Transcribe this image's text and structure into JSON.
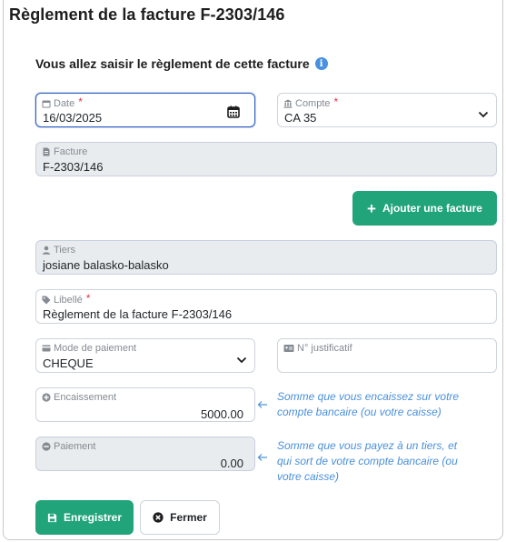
{
  "title": "Règlement de la facture F-2303/146",
  "subtitle": "Vous allez saisir le règlement de cette facture",
  "info_icon_char": "i",
  "date": {
    "label": "Date",
    "value": "16/03/2025",
    "required_mark": "*"
  },
  "compte": {
    "label": "Compte",
    "value": "CA 35",
    "required_mark": "*"
  },
  "facture": {
    "label": "Facture",
    "value": "F-2303/146"
  },
  "add_invoice_button": {
    "icon": "+",
    "label": "Ajouter une facture"
  },
  "tiers": {
    "label": "Tiers",
    "value": "josiane balasko-balasko"
  },
  "libelle": {
    "label": "Libellé",
    "value": "Règlement de la facture F-2303/146",
    "required_mark": "*"
  },
  "mode_paiement": {
    "label": "Mode de paiement",
    "value": "CHEQUE"
  },
  "justificatif": {
    "label": "N° justificatif",
    "value": ""
  },
  "encaissement": {
    "label": "Encaissement",
    "value": "5000.00",
    "hint_line1": "Somme que vous encaissez sur votre",
    "hint_line2": "compte bancaire (ou votre caisse)"
  },
  "paiement": {
    "label": "Paiement",
    "value": "0.00",
    "hint_line1": "Somme que vous payez à un tiers, et",
    "hint_line2": "qui sort de votre compte bancaire (ou",
    "hint_line3": "votre caisse)"
  },
  "save_button": {
    "label": "Enregistrer"
  },
  "close_button": {
    "label": "Fermer"
  },
  "colors": {
    "accent_green": "#22a47a",
    "hint_blue": "#4a90d9",
    "required_red": "#dc3545"
  }
}
